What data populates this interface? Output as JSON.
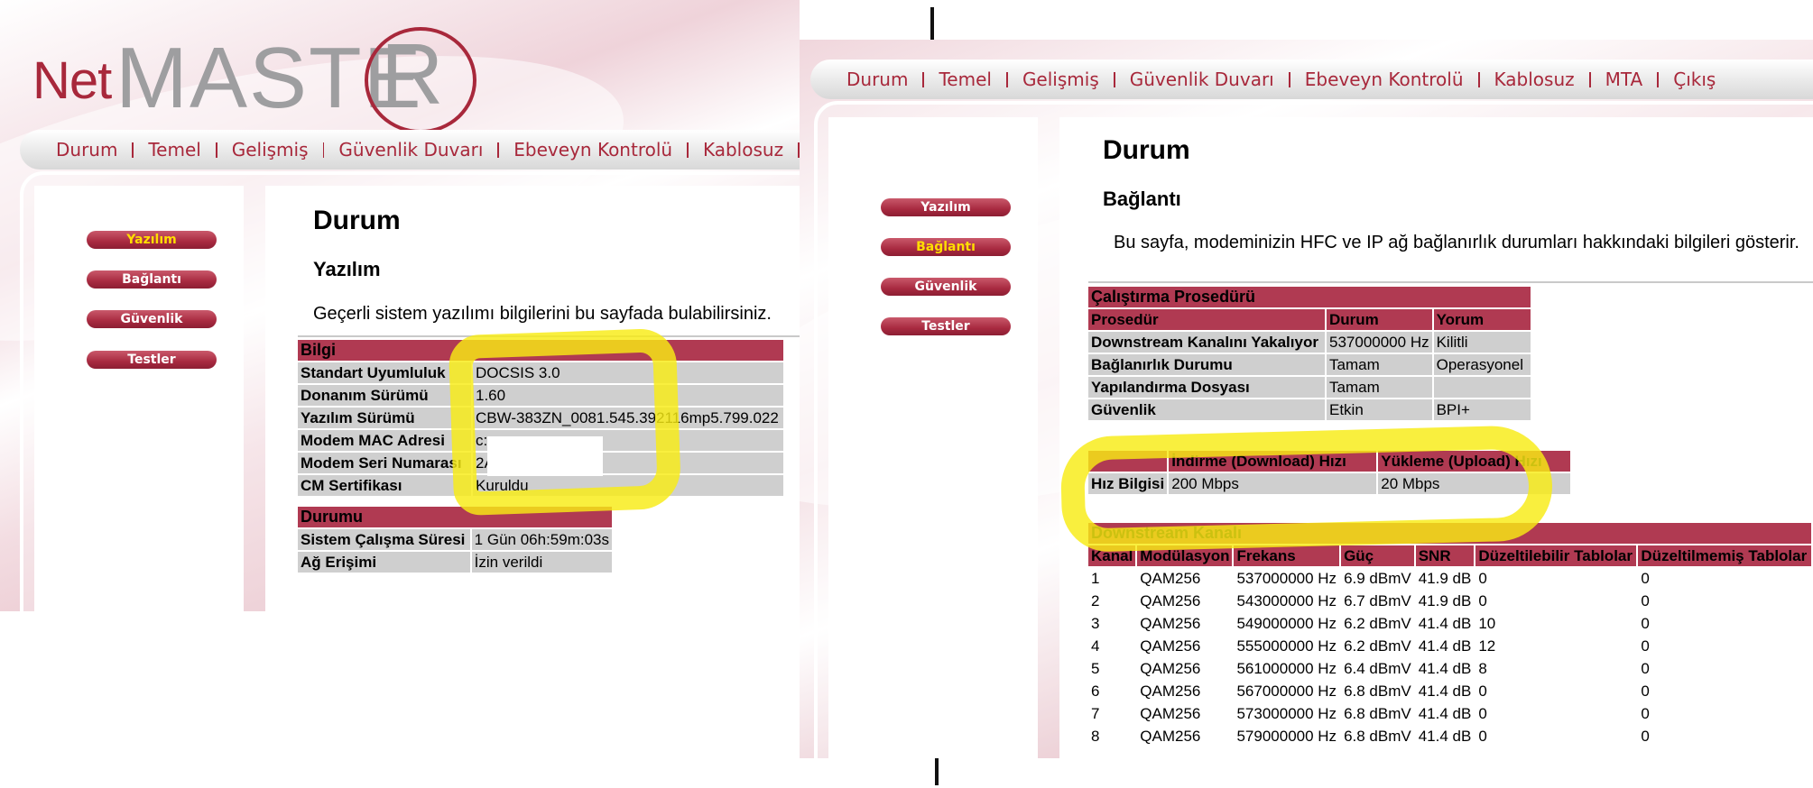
{
  "left": {
    "logo": {
      "net": "Net",
      "master": "MASTE",
      "r": "R"
    },
    "menu": [
      "Durum",
      "Temel",
      "Gelişmiş",
      "Güvenlik Duvarı",
      "Ebeveyn Kontrolü",
      "Kablosuz"
    ],
    "sidebar": [
      "Yazılım",
      "Bağlantı",
      "Güvenlik",
      "Testler"
    ],
    "active_sidebar": "Yazılım",
    "title": "Durum",
    "subtitle": "Yazılım",
    "description": "Geçerli sistem yazılımı bilgilerini bu sayfada bulabilirsiniz.",
    "bilgi": {
      "header": "Bilgi",
      "rows": [
        {
          "label": "Standart Uyumluluk",
          "value": "DOCSIS 3.0"
        },
        {
          "label": "Donanım Sürümü",
          "value": "1.60"
        },
        {
          "label": "Yazılım Sürümü",
          "value": "CBW-383ZN_0081.545.392116mp5.799.022"
        },
        {
          "label": "Modem MAC Adresi",
          "value": "c:"
        },
        {
          "label": "Modem Seri Numarası",
          "value": "2A"
        },
        {
          "label": "CM Sertifikası",
          "value": "Kuruldu"
        }
      ]
    },
    "durumu": {
      "header": "Durumu",
      "rows": [
        {
          "label": "Sistem Çalışma Süresi",
          "value": "1 Gün 06h:59m:03s"
        },
        {
          "label": "Ağ Erişimi",
          "value": "İzin verildi"
        }
      ]
    }
  },
  "right": {
    "menu": [
      "Durum",
      "Temel",
      "Gelişmiş",
      "Güvenlik Duvarı",
      "Ebeveyn Kontrolü",
      "Kablosuz",
      "MTA",
      "Çıkış"
    ],
    "sidebar": [
      "Yazılım",
      "Bağlantı",
      "Güvenlik",
      "Testler"
    ],
    "active_sidebar": "Bağlantı",
    "title": "Durum",
    "subtitle": "Bağlantı",
    "description": "Bu sayfa, modeminizin HFC ve IP ağ bağlanırlık durumları hakkındaki bilgileri gösterir.",
    "procedure": {
      "header": "Çalıştırma Prosedürü",
      "columns": [
        "Prosedür",
        "Durum",
        "Yorum"
      ],
      "rows": [
        [
          "Downstream Kanalını Yakalıyor",
          "537000000 Hz",
          "Kilitli"
        ],
        [
          "Bağlanırlık Durumu",
          "Tamam",
          "Operasyonel"
        ],
        [
          "Yapılandırma Dosyası",
          "Tamam",
          ""
        ],
        [
          "Güvenlik",
          "Etkin",
          "BPI+"
        ]
      ]
    },
    "speed": {
      "columns": [
        "",
        "İndirme (Download) Hızı",
        "Yükleme (Upload) Hızı"
      ],
      "row": [
        "Hız Bilgisi",
        "200 Mbps",
        "20 Mbps"
      ]
    },
    "downstream": {
      "header": "Downstream Kanalı",
      "columns": [
        "Kanal",
        "Modülasyon",
        "Frekans",
        "Güç",
        "SNR",
        "Düzeltilebilir Tablolar",
        "Düzeltilmemiş Tablolar"
      ],
      "rows": [
        [
          "1",
          "QAM256",
          "537000000 Hz",
          "6.9 dBmV",
          "41.9 dB",
          "0",
          "0"
        ],
        [
          "2",
          "QAM256",
          "543000000 Hz",
          "6.7 dBmV",
          "41.9 dB",
          "0",
          "0"
        ],
        [
          "3",
          "QAM256",
          "549000000 Hz",
          "6.2 dBmV",
          "41.4 dB",
          "10",
          "0"
        ],
        [
          "4",
          "QAM256",
          "555000000 Hz",
          "6.2 dBmV",
          "41.4 dB",
          "12",
          "0"
        ],
        [
          "5",
          "QAM256",
          "561000000 Hz",
          "6.4 dBmV",
          "41.4 dB",
          "8",
          "0"
        ],
        [
          "6",
          "QAM256",
          "567000000 Hz",
          "6.8 dBmV",
          "41.4 dB",
          "0",
          "0"
        ],
        [
          "7",
          "QAM256",
          "573000000 Hz",
          "6.8 dBmV",
          "41.4 dB",
          "0",
          "0"
        ],
        [
          "8",
          "QAM256",
          "579000000 Hz",
          "6.8 dBmV",
          "41.4 dB",
          "0",
          "0"
        ]
      ]
    }
  },
  "colors": {
    "brand": "#a8283b",
    "table_header": "#b03a52",
    "table_cell": "#cfcfcf",
    "highlight": "#f8ec14",
    "active_nav": "#ffde00"
  }
}
